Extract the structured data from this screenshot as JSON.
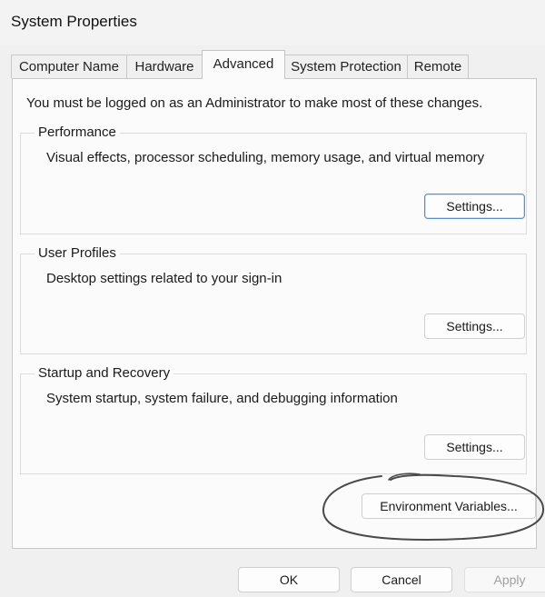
{
  "window": {
    "title": "System Properties"
  },
  "tabs": [
    {
      "label": "Computer Name"
    },
    {
      "label": "Hardware"
    },
    {
      "label": "Advanced",
      "active": true
    },
    {
      "label": "System Protection"
    },
    {
      "label": "Remote"
    }
  ],
  "advanced": {
    "admin_note": "You must be logged on as an Administrator to make most of these changes.",
    "performance": {
      "title": "Performance",
      "description": "Visual effects, processor scheduling, memory usage, and virtual memory",
      "button": "Settings..."
    },
    "user_profiles": {
      "title": "User Profiles",
      "description": "Desktop settings related to your sign-in",
      "button": "Settings..."
    },
    "startup_recovery": {
      "title": "Startup and Recovery",
      "description": "System startup, system failure, and debugging information",
      "button": "Settings..."
    },
    "env_button": "Environment Variables..."
  },
  "footer": {
    "ok": "OK",
    "cancel": "Cancel",
    "apply": "Apply"
  },
  "colors": {
    "focus_border": "#5b8fc7",
    "annotation_stroke": "#4a4a4a"
  }
}
